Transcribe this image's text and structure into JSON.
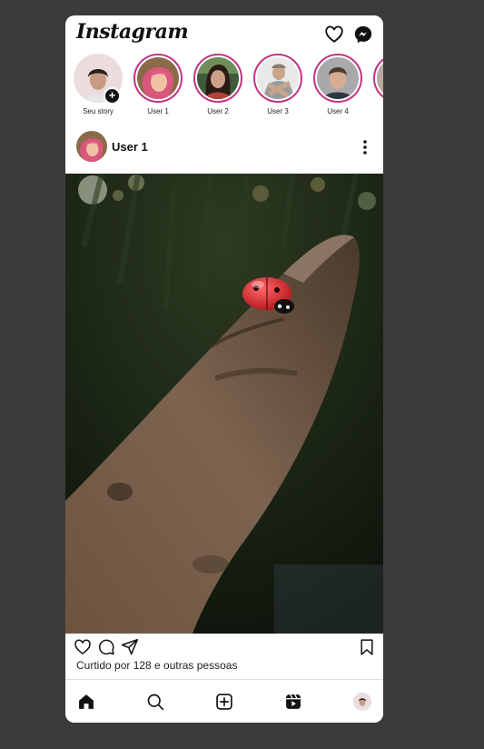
{
  "header": {
    "logo": "Instagram"
  },
  "stories": [
    {
      "label": "Seu story",
      "self": true
    },
    {
      "label": "User 1"
    },
    {
      "label": "User 2"
    },
    {
      "label": "User 3"
    },
    {
      "label": "User 4"
    }
  ],
  "post": {
    "username": "User 1",
    "likes_text": "Curtido por 128 e outras pessoas"
  },
  "icons": {
    "header": [
      "heart-icon",
      "messenger-icon"
    ],
    "post_actions": [
      "heart-icon",
      "comment-icon",
      "share-icon",
      "bookmark-icon"
    ],
    "nav": [
      "home-icon",
      "search-icon",
      "new-post-icon",
      "reels-icon",
      "profile-avatar"
    ]
  },
  "colors": {
    "story_ring": "#c13584",
    "background": "#3b3b3b"
  }
}
